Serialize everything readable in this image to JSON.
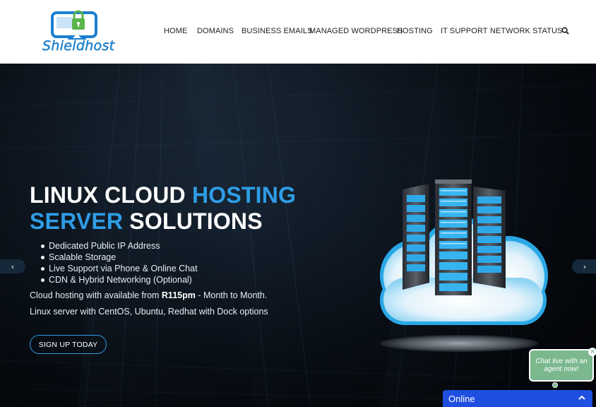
{
  "brand": {
    "name": "Shieldhost"
  },
  "nav": {
    "items": [
      {
        "label": "HOME"
      },
      {
        "label": "DOMAINS"
      },
      {
        "label": "BUSINESS EMAILS"
      },
      {
        "label": "MANAGED WORDPRESS"
      },
      {
        "label": "HOSTING"
      },
      {
        "label": "IT SUPPORT"
      },
      {
        "label": "NETWORK STATUS"
      }
    ],
    "search_icon": "search-icon"
  },
  "hero": {
    "headline": {
      "part1": "LINUX CLOUD ",
      "part2": "HOSTING",
      "part3": "SERVER",
      "part4": " SOLUTIONS"
    },
    "bullets": [
      "Dedicated Public IP Address",
      "Scalable Storage",
      "Live Support via Phone & Online Chat",
      "CDN & Hybrid Networking (Optional)"
    ],
    "desc1": {
      "pre": "Cloud hosting with available from ",
      "price": "R115pm",
      "post": " - Month to Month."
    },
    "desc2": "Linux server with CentOS, Ubuntu, Redhat with Dock options",
    "cta": "SIGN UP TODAY",
    "prev_arrow": "‹",
    "next_arrow": "›"
  },
  "chat": {
    "bubble_text": "Chat live with an agent now!",
    "close_glyph": "×",
    "status": "Online"
  },
  "colors": {
    "accent": "#2f9de6",
    "chat_green": "#7bb88e",
    "online_bar": "#1f4fe0",
    "hero_bg": "#0a111a"
  }
}
